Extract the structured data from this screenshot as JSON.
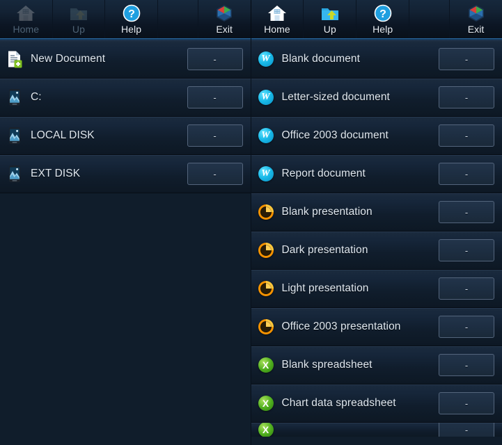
{
  "toolbars": {
    "left": {
      "buttons": [
        {
          "label": "Home",
          "icon": "home-icon",
          "enabled": false
        },
        {
          "label": "Up",
          "icon": "folder-up-icon",
          "enabled": false
        },
        {
          "label": "Help",
          "icon": "help-icon",
          "enabled": true
        },
        {
          "label": "",
          "icon": "spacer",
          "enabled": false
        },
        {
          "label": "Exit",
          "icon": "libreoffice-logo-icon",
          "enabled": true
        }
      ]
    },
    "right": {
      "buttons": [
        {
          "label": "Home",
          "icon": "home-icon",
          "enabled": true
        },
        {
          "label": "Up",
          "icon": "folder-up-icon",
          "enabled": true
        },
        {
          "label": "Help",
          "icon": "help-icon",
          "enabled": true
        },
        {
          "label": "",
          "icon": "spacer",
          "enabled": false
        },
        {
          "label": "Exit",
          "icon": "libreoffice-logo-icon",
          "enabled": true
        }
      ]
    }
  },
  "left_pane": {
    "rows": [
      {
        "label": "New Document",
        "icon": "new-document-icon",
        "action": "-"
      },
      {
        "label": "C:",
        "icon": "drive-icon",
        "action": "-"
      },
      {
        "label": "LOCAL DISK",
        "icon": "drive-icon",
        "action": "-"
      },
      {
        "label": "EXT DISK",
        "icon": "drive-icon",
        "action": "-"
      }
    ]
  },
  "right_pane": {
    "rows": [
      {
        "label": "Blank document",
        "icon": "word-document-icon",
        "action": "-"
      },
      {
        "label": "Letter-sized document",
        "icon": "word-document-icon",
        "action": "-"
      },
      {
        "label": "Office 2003 document",
        "icon": "word-document-icon",
        "action": "-"
      },
      {
        "label": "Report document",
        "icon": "word-document-icon",
        "action": "-"
      },
      {
        "label": "Blank presentation",
        "icon": "presentation-icon",
        "action": "-"
      },
      {
        "label": "Dark presentation",
        "icon": "presentation-icon",
        "action": "-"
      },
      {
        "label": "Light presentation",
        "icon": "presentation-icon",
        "action": "-"
      },
      {
        "label": "Office 2003 presentation",
        "icon": "presentation-icon",
        "action": "-"
      },
      {
        "label": "Blank spreadsheet",
        "icon": "spreadsheet-icon",
        "action": "-"
      },
      {
        "label": "Chart data spreadsheet",
        "icon": "spreadsheet-icon",
        "action": "-"
      },
      {
        "label": "",
        "icon": "spreadsheet-icon",
        "action": "-",
        "partial": true
      }
    ]
  },
  "icon_glyphs": {
    "word": "W",
    "excel": "X",
    "help": "?"
  },
  "colors": {
    "background": "#101d2b",
    "toolbar_top": "#16283c",
    "accent_blue": "#2d6ea8",
    "word_blue": "#18b9e8",
    "presentation_orange": "#f59200",
    "spreadsheet_green": "#4fae1e",
    "text": "#dfe7ef",
    "disabled_text": "#4e6274"
  }
}
